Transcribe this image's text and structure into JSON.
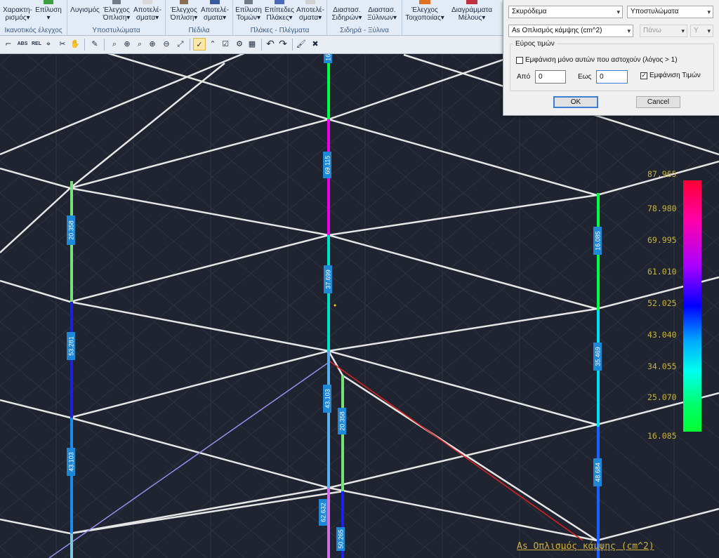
{
  "ribbon": {
    "groups": [
      {
        "label": "Ικανοτικός έλεγχος",
        "buttons": [
          {
            "l1": "Χαρακτη-",
            "l2": "ρισμός▾"
          },
          {
            "l1": "Επίλυση",
            "l2": "▾"
          }
        ]
      },
      {
        "label": "Υποστυλώματα",
        "buttons": [
          {
            "l1": "Λυγισμός",
            "l2": ""
          },
          {
            "l1": "Έλεγχος",
            "l2": "Όπλιση▾"
          },
          {
            "l1": "Αποτελέ-",
            "l2": "σματα▾"
          }
        ]
      },
      {
        "label": "Πέδιλα",
        "buttons": [
          {
            "l1": "Έλεγχος",
            "l2": "Όπλιση▾"
          },
          {
            "l1": "Αποτελέ-",
            "l2": "σματα▾"
          }
        ]
      },
      {
        "label": "Πλάκες - Πλέγματα",
        "buttons": [
          {
            "l1": "Επίλυση",
            "l2": "Τομών▾"
          },
          {
            "l1": "Επίπεδες",
            "l2": "Πλάκες▾"
          },
          {
            "l1": "Αποτελέ-",
            "l2": "σματα▾"
          }
        ]
      },
      {
        "label": "Σιδηρά - Ξύλινα",
        "buttons": [
          {
            "l1": "Διαστασ.",
            "l2": "Σιδηρών▾"
          },
          {
            "l1": "Διαστασ.",
            "l2": "Ξύλινων▾"
          }
        ]
      },
      {
        "label": "",
        "buttons": [
          {
            "l1": "Έλεγχος",
            "l2": "Τοιχοποιίας▾"
          },
          {
            "l1": "Διαγράμματα",
            "l2": "Μέλους▾"
          }
        ]
      }
    ]
  },
  "toolbar": {
    "abs_label": "ABS",
    "rel_label": "REL",
    "tools": [
      "select-tool-icon",
      "abs-icon",
      "rel-icon",
      "snap-icon",
      "scissors-icon",
      "hand-icon",
      "pencil-icon",
      "zoom-window-icon",
      "zoom-in-icon",
      "zoom-dynamic-icon",
      "zoom-plus-icon",
      "zoom-minus-icon",
      "zoom-extents-icon",
      "check-tool-icon",
      "polyline-icon",
      "checkbox-icon",
      "settings-icon",
      "grid-icon",
      "undo-icon",
      "redo-icon",
      "brush-icon",
      "close-x-icon"
    ]
  },
  "panel": {
    "material_select": "Σκυρόδεμα",
    "element_select": "Υποστυλώματα",
    "quantity_select": "As Οπλισμός κάμψης (cm^2)",
    "position_select": "Πάνω",
    "axis_select": "Y",
    "range_group_label": "Εύρος τιμών",
    "show_only_failing_label": "Εμφάνιση μόνο αυτών που αστοχούν (λόγος > 1)",
    "show_only_failing_checked": false,
    "from_label": "Από",
    "from_value": "0",
    "to_label": "Εως",
    "to_value": "0",
    "show_values_label": "Εμφάνιση Τιμών",
    "show_values_checked": true,
    "ok_label": "OK",
    "cancel_label": "Cancel"
  },
  "color_scale": {
    "values": [
      "87.965",
      "78.980",
      "69.995",
      "61.010",
      "52.025",
      "43.040",
      "34.055",
      "25.070",
      "16.085"
    ],
    "max_color": "#ff0033",
    "min_color": "#00ff33"
  },
  "drawing": {
    "title": "As Οπλισμός κάμψης (cm^2)",
    "member_labels": [
      {
        "text": "16.0",
        "color": "#00ff44"
      },
      {
        "text": "69.115",
        "color": "#ee00ee"
      },
      {
        "text": "37.699",
        "color": "#00e0c8"
      },
      {
        "text": "20.358",
        "color": "#78e078"
      },
      {
        "text": "53.281",
        "color": "#1a22e0"
      },
      {
        "text": "43.103",
        "color": "#1a8cf0"
      },
      {
        "text": "16.085",
        "color": "#00ff44"
      },
      {
        "text": "35.469",
        "color": "#00e0f0"
      },
      {
        "text": "43.103",
        "color": "#5ab0e6"
      },
      {
        "text": "20.358",
        "color": "#78e078"
      },
      {
        "text": "48.684",
        "color": "#1a60ff"
      },
      {
        "text": "62.632",
        "color": "#d070e8"
      },
      {
        "text": "50.265",
        "color": "#1a20f0"
      }
    ]
  }
}
